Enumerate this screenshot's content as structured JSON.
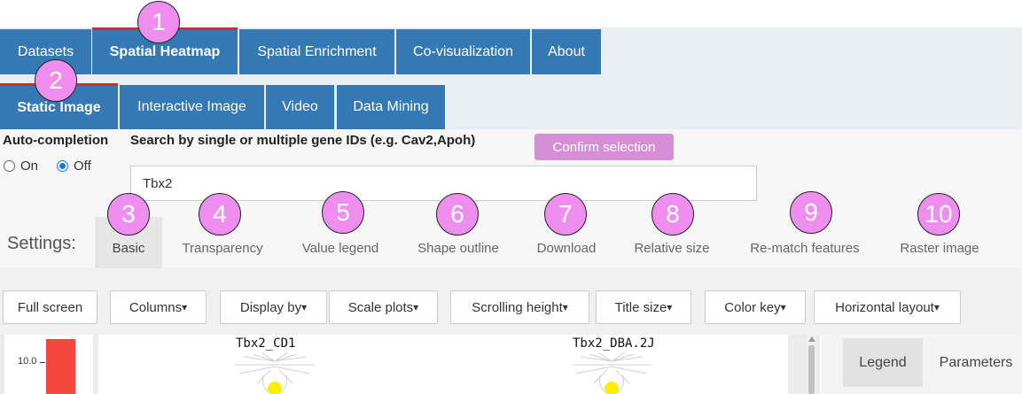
{
  "top_tabs": [
    {
      "label": "Datasets",
      "active": false
    },
    {
      "label": "Spatial Heatmap",
      "active": true
    },
    {
      "label": "Spatial Enrichment",
      "active": false
    },
    {
      "label": "Co-visualization",
      "active": false
    },
    {
      "label": "About",
      "active": false
    }
  ],
  "sub_tabs": [
    {
      "label": "Static Image",
      "active": true
    },
    {
      "label": "Interactive Image",
      "active": false
    },
    {
      "label": "Video",
      "active": false
    },
    {
      "label": "Data Mining",
      "active": false
    }
  ],
  "badges": [
    "1",
    "2",
    "3",
    "4",
    "5",
    "6",
    "7",
    "8",
    "9",
    "10"
  ],
  "search": {
    "autocompletion_label": "Auto-completion",
    "radio_on": "On",
    "radio_off": "Off",
    "selected": "Off",
    "search_label": "Search by single or multiple gene IDs (e.g. Cav2,Apoh)",
    "confirm_label": "Confirm selection",
    "gene_value": "Tbx2"
  },
  "settings": {
    "label": "Settings:",
    "tabs": [
      "Basic",
      "Transparency",
      "Value legend",
      "Shape outline",
      "Download",
      "Relative size",
      "Re-match features",
      "Raster image"
    ],
    "active": "Basic"
  },
  "toolbar": {
    "full_screen": "Full screen",
    "dropdowns": [
      "Columns",
      "Display by",
      "Scale plots",
      "Scrolling height",
      "Title size",
      "Color key",
      "Horizontal layout"
    ]
  },
  "plot": {
    "scale_tick": "10.0",
    "titles": [
      "Tbx2_CD1",
      "Tbx2_DBA.2J"
    ]
  },
  "side_panel": {
    "tabs": [
      "Legend",
      "Parameters"
    ],
    "active": "Legend"
  },
  "colors": {
    "tab_blue": "#3579b4",
    "active_red": "#d52b25",
    "badge_pink": "#ee8ff0",
    "confirm_pink": "#d68ed6",
    "scale_red": "#f4473b",
    "cell_yellow": "#ffee00"
  }
}
